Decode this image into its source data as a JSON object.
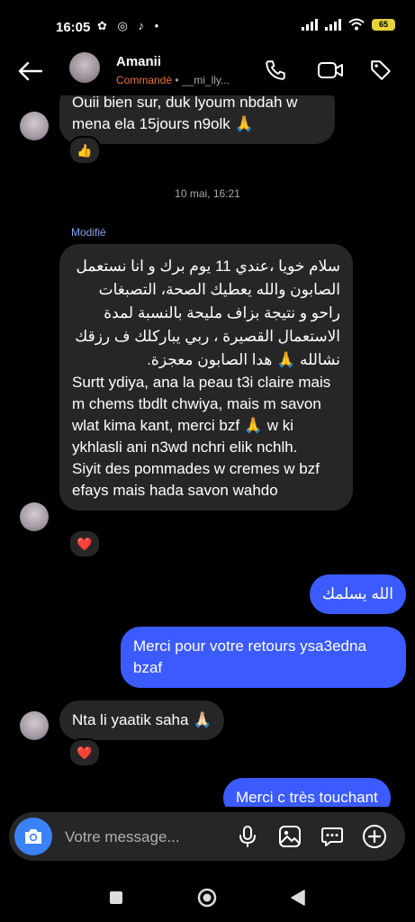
{
  "status": {
    "time": "16:05",
    "left_icons": [
      "flower-icon",
      "instagram-icon",
      "tiktok-icon",
      "dot-icon"
    ],
    "battery": "65"
  },
  "header": {
    "name": "Amanii",
    "subtitle_prefix": "Commandé",
    "subtitle_rest": " • __mi_lly..."
  },
  "messages": {
    "top_partial": {
      "line1": "Ouii bien sur, duk lyoum nbdah w",
      "line2": "mena ela 15jours n9olk 🙏",
      "reaction": "👍"
    },
    "timestamp": "10 mai, 16:21",
    "edited_label": "Modifié",
    "long": {
      "arabic": "سلام خويا ،عندي 11 يوم برك و انا نستعمل الصابون والله يعطيك الصحة، التصبغات راحو و نتيجة بزاف مليحة بالنسبة لمدة الاستعمال القصيرة ، ربي يباركلك ف رزقك نشالله 🙏 هدا الصابون معجزة.",
      "latin1": "Surtt ydiya, ana la peau t3i claire mais m chems tbdlt chwiya, mais m savon wlat kima kant, merci bzf 🙏 w ki ykhlasli ani n3wd nchri elik nchlh.",
      "latin2": "Siyit des pommades w cremes w bzf efays mais hada savon wahdo",
      "reaction": "❤️"
    },
    "out1": "الله يسلمك",
    "out2": "Merci pour votre retours ysa3edna bzaf",
    "in2": {
      "text": "Nta li yaatik saha 🙏🏻",
      "reaction": "❤️"
    },
    "out3": "Merci c très touchant"
  },
  "composer": {
    "placeholder": "Votre message..."
  },
  "colors": {
    "accent": "#3b5bfe",
    "incoming_bg": "#262626",
    "commande": "#e5753c",
    "edited": "#8c9ef5"
  }
}
